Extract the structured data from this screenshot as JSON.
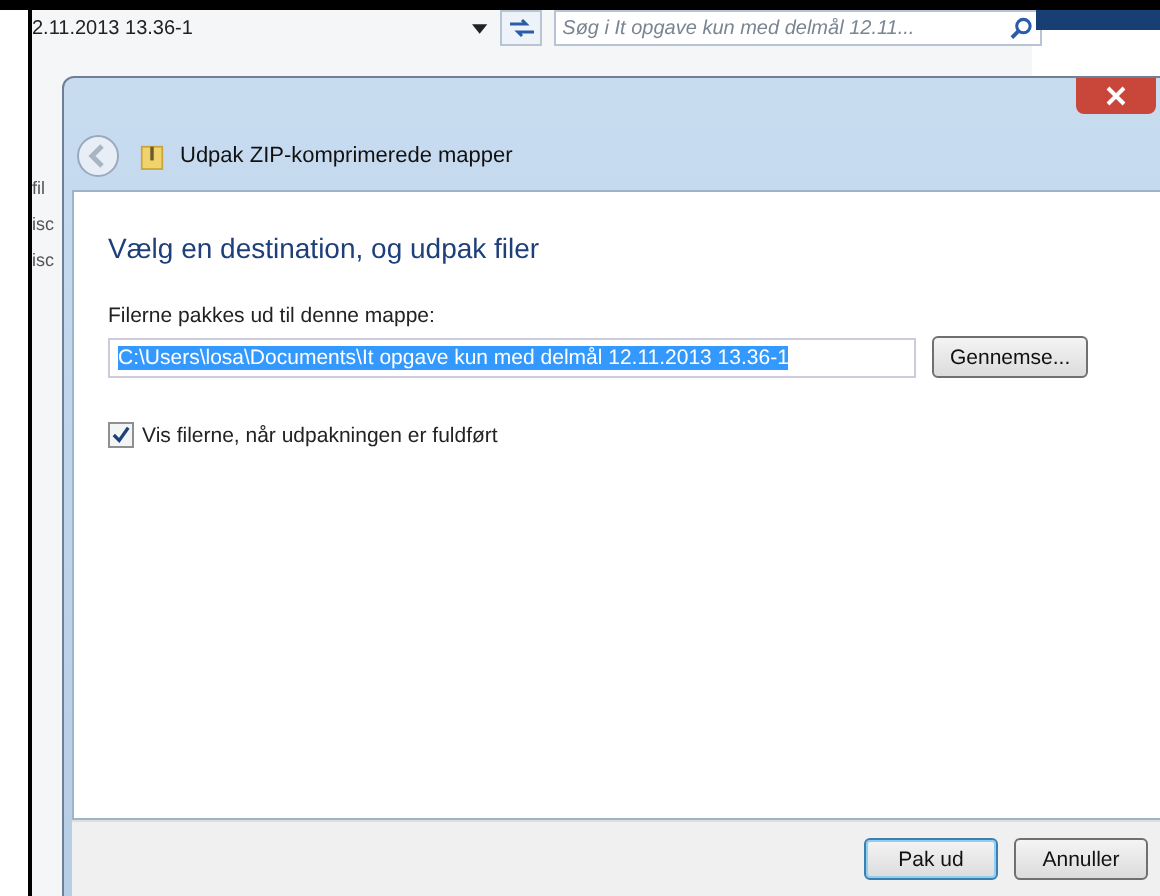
{
  "background_window": {
    "address": "2.11.2013 13.36-1",
    "search_placeholder": "Søg i It opgave kun med delmål 12.11...",
    "side_texts": [
      "fil",
      "isc",
      "isc"
    ]
  },
  "dialog": {
    "title": "Udpak ZIP-komprimerede mapper",
    "heading": "Vælg en destination, og udpak filer",
    "field_label": "Filerne pakkes ud til denne mappe:",
    "path": "C:\\Users\\losa\\Documents\\It opgave kun med delmål 12.11.2013 13.36-1",
    "browse": "Gennemse...",
    "show_files": {
      "label": "Vis filerne, når udpakningen er fuldført",
      "checked": true
    },
    "buttons": [
      {
        "label": "Pak ud",
        "default": true
      },
      {
        "label": "Annuller",
        "default": false
      }
    ]
  }
}
